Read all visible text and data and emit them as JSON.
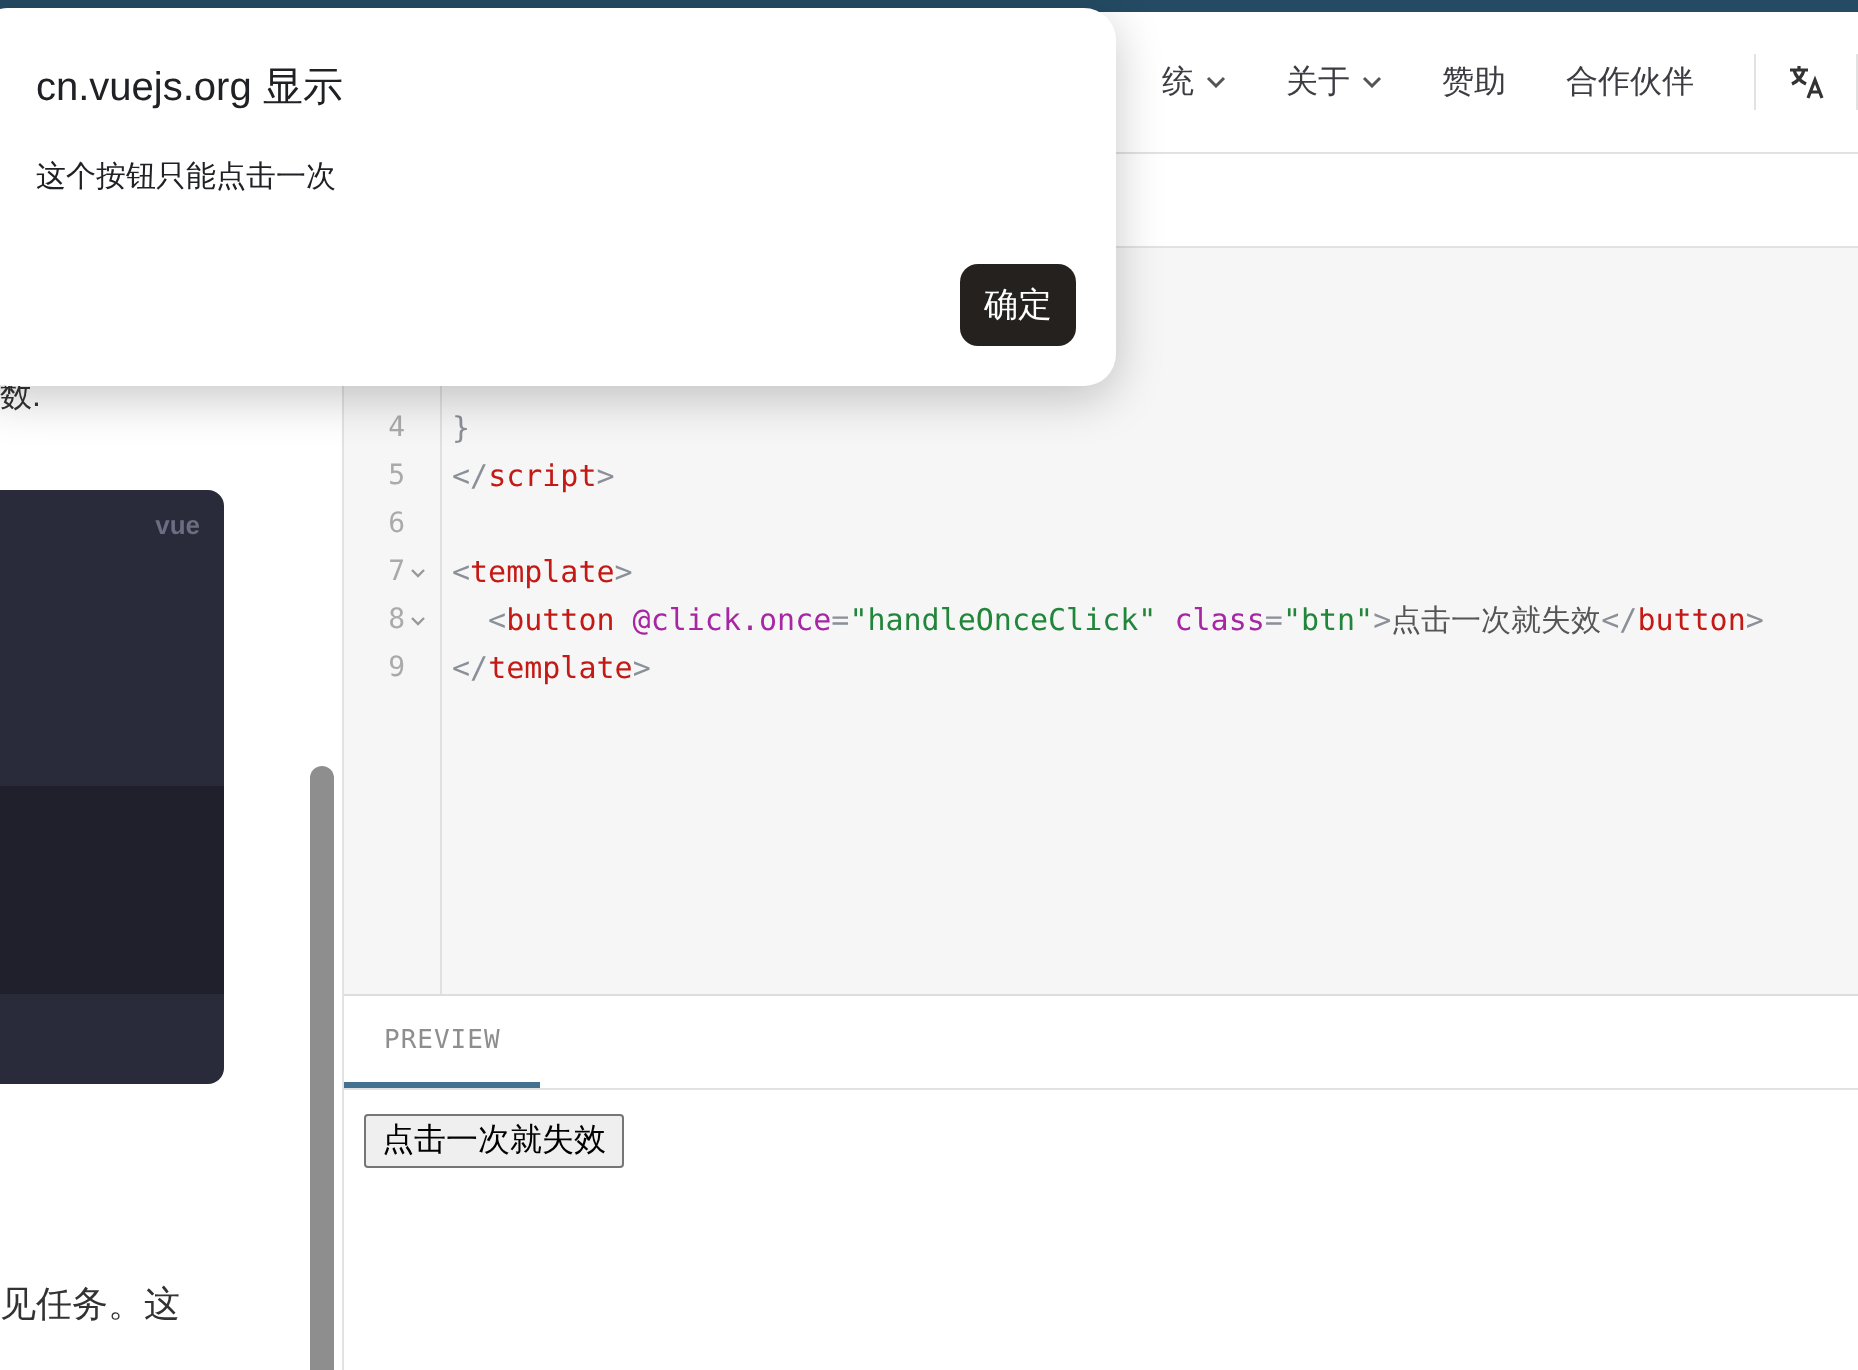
{
  "nav": {
    "items": [
      {
        "label": "统",
        "dropdown": true
      },
      {
        "label": "关于",
        "dropdown": true
      },
      {
        "label": "赞助",
        "dropdown": false
      },
      {
        "label": "合作伙伴",
        "dropdown": false
      }
    ]
  },
  "article": {
    "text_1": "数.",
    "code_card": {
      "language": "vue"
    },
    "text_2": "见任务。这"
  },
  "editor": {
    "lines": [
      {
        "number": "4",
        "foldable": false,
        "tokens": [
          {
            "kind": "punct",
            "text": "}"
          }
        ]
      },
      {
        "number": "5",
        "foldable": false,
        "tokens": [
          {
            "kind": "punct",
            "text": "</"
          },
          {
            "kind": "tag",
            "text": "script"
          },
          {
            "kind": "punct",
            "text": ">"
          }
        ]
      },
      {
        "number": "6",
        "foldable": false
      },
      {
        "number": "7",
        "foldable": true,
        "tokens": [
          {
            "kind": "punct",
            "text": "<"
          },
          {
            "kind": "tag",
            "text": "template"
          },
          {
            "kind": "punct",
            "text": ">"
          }
        ]
      },
      {
        "number": "8",
        "foldable": true,
        "tokens": [
          {
            "kind": "punct",
            "text": "  <"
          },
          {
            "kind": "tag",
            "text": "button"
          },
          {
            "kind": "attr",
            "text": " @click.once"
          },
          {
            "kind": "punct",
            "text": "="
          },
          {
            "kind": "string",
            "text": "\"handleOnceClick\""
          },
          {
            "kind": "attr",
            "text": " class"
          },
          {
            "kind": "punct",
            "text": "="
          },
          {
            "kind": "string",
            "text": "\"btn\""
          },
          {
            "kind": "punct",
            "text": ">"
          },
          {
            "kind": "text",
            "text": "点击一次就失效"
          },
          {
            "kind": "punct",
            "text": "</"
          },
          {
            "kind": "tag",
            "text": "button"
          },
          {
            "kind": "punct",
            "text": ">"
          }
        ]
      },
      {
        "number": "9",
        "foldable": false,
        "tokens": [
          {
            "kind": "punct",
            "text": "</"
          },
          {
            "kind": "tag",
            "text": "template"
          },
          {
            "kind": "punct",
            "text": ">"
          }
        ]
      }
    ]
  },
  "preview": {
    "tabs": [
      {
        "label": "PREVIEW",
        "selected": true
      }
    ],
    "button": "点击一次就失效"
  },
  "dialog": {
    "title": "cn.vuejs.org 显示",
    "message": "这个按钮只能点击一次",
    "button": "确定"
  }
}
